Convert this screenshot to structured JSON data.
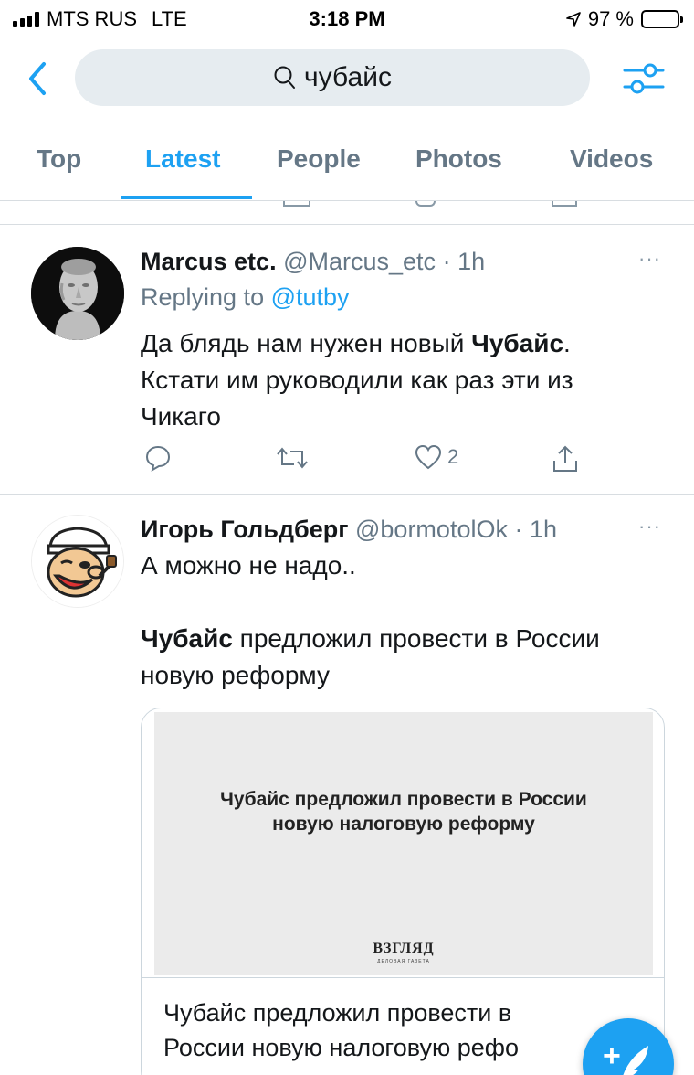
{
  "status_bar": {
    "carrier": "MTS RUS",
    "network": "LTE",
    "time": "3:18 PM",
    "battery_percent": "97 %",
    "battery_level": 0.97
  },
  "search": {
    "query": "чубайс",
    "icons": {
      "back": "chevron-left-icon",
      "search": "search-icon",
      "filter": "sliders-icon"
    }
  },
  "tabs": [
    {
      "label": "Top",
      "active": false
    },
    {
      "label": "Latest",
      "active": true
    },
    {
      "label": "People",
      "active": false
    },
    {
      "label": "Photos",
      "active": false
    },
    {
      "label": "Videos",
      "active": false
    }
  ],
  "colors": {
    "accent": "#1da1f2",
    "muted": "#657786",
    "separator": "#d8dde1",
    "search_bg": "#e6ecf0"
  },
  "tweets": [
    {
      "name": "Marcus etc.",
      "handle": "@Marcus_etc",
      "sep": "·",
      "time": "1h",
      "replying_prefix": "Replying to",
      "replying_to": "@tutby",
      "text_before": "Да блядь нам нужен новый ",
      "text_bold": "Чубайс",
      "text_after": ".",
      "text_line2": "Кстати им руководили как раз эти из",
      "text_line3": "Чикаго",
      "likes": "2",
      "more": "···"
    },
    {
      "name": "Игорь Гольдберг",
      "handle": "@bormotolOk",
      "sep": "·",
      "time": "1h",
      "line1": "А можно не надо..",
      "quote_bold": "Чубайс",
      "quote_rest": " предложил провести в России",
      "quote_line2": "новую реформу",
      "more": "···",
      "card": {
        "image_title": "Чубайс предложил провести в России новую налоговую реформу",
        "logo": "ВЗГЛЯД",
        "logo_sub": "ДЕЛОВАЯ ГАЗЕТА",
        "title_line1": "Чубайс предложил провести в",
        "title_line2": "России новую налоговую рефо"
      }
    }
  ],
  "compose": {
    "icon": "compose-feather-icon",
    "plus": "+"
  }
}
